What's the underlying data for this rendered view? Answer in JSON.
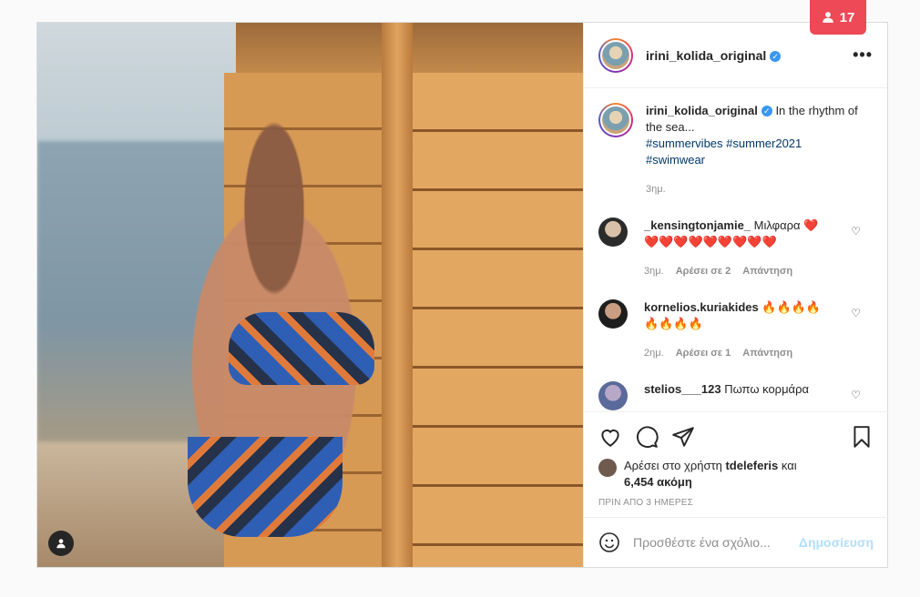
{
  "badge": {
    "icon": "person-icon",
    "count": "17",
    "color": "#ed4956"
  },
  "post": {
    "username": "irini_kolida_original",
    "caption_text": "In the rhythm of the sea...",
    "hashtags": [
      "#summervibes",
      "#summer2021",
      "#swimwear"
    ],
    "caption_time": "3ημ."
  },
  "comments": [
    {
      "user": "_kensingtonjamie_",
      "text": "Μιλφαρα ❤️ ❤️❤️❤️❤️❤️❤️❤️❤️❤️",
      "time": "3ημ.",
      "likes": "Αρέσει σε 2",
      "reply": "Απάντηση"
    },
    {
      "user": "kornelios.kuriakides",
      "text": "🔥🔥🔥🔥🔥🔥🔥🔥",
      "time": "2ημ.",
      "likes": "Αρέσει σε 1",
      "reply": "Απάντηση"
    },
    {
      "user": "stelios___123",
      "text": "Πωπω κορμάρα"
    }
  ],
  "likes": {
    "prefix": "Αρέσει στο χρήστη",
    "user": "tdeleferis",
    "conj": "και",
    "count": "6,454 ακόμη"
  },
  "posted_ago": "ΠΡΙΝ ΑΠΟ 3 ΗΜΕΡΕΣ",
  "add_comment": {
    "placeholder": "Προσθέστε ένα σχόλιο...",
    "post_label": "Δημοσίευση"
  }
}
